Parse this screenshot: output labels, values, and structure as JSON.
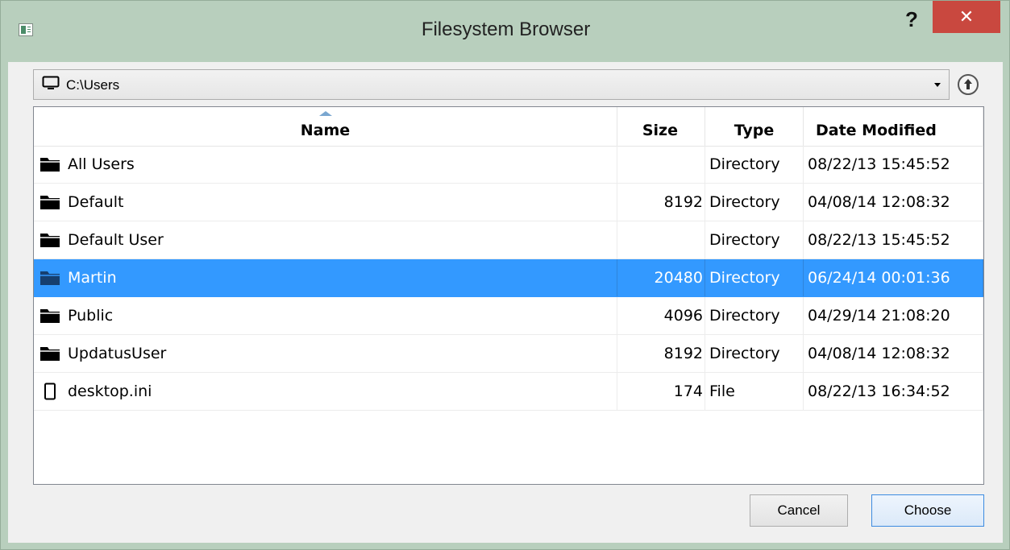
{
  "window": {
    "title": "Filesystem Browser",
    "help_label": "?",
    "close_label": "✕"
  },
  "pathbar": {
    "path": "C:\\Users"
  },
  "columns": {
    "name": "Name",
    "size": "Size",
    "type": "Type",
    "date": "Date Modified",
    "sorted_by": "Name"
  },
  "rows": [
    {
      "name": "All Users",
      "size": "",
      "type": "Directory",
      "date": "08/22/13 15:45:52",
      "icon": "folder-icon",
      "selected": false
    },
    {
      "name": "Default",
      "size": "8192",
      "type": "Directory",
      "date": "04/08/14 12:08:32",
      "icon": "folder-icon",
      "selected": false
    },
    {
      "name": "Default User",
      "size": "",
      "type": "Directory",
      "date": "08/22/13 15:45:52",
      "icon": "folder-icon",
      "selected": false
    },
    {
      "name": "Martin",
      "size": "20480",
      "type": "Directory",
      "date": "06/24/14 00:01:36",
      "icon": "folder-icon",
      "selected": true
    },
    {
      "name": "Public",
      "size": "4096",
      "type": "Directory",
      "date": "04/29/14 21:08:20",
      "icon": "folder-icon",
      "selected": false
    },
    {
      "name": "UpdatusUser",
      "size": "8192",
      "type": "Directory",
      "date": "04/08/14 12:08:32",
      "icon": "folder-icon",
      "selected": false
    },
    {
      "name": "desktop.ini",
      "size": "174",
      "type": "File",
      "date": "08/22/13 16:34:52",
      "icon": "file-icon",
      "selected": false
    }
  ],
  "buttons": {
    "cancel": "Cancel",
    "choose": "Choose"
  },
  "colors": {
    "frame": "#b8cfbd",
    "close": "#c9483f",
    "selection": "#3399ff",
    "selected_icon": "#163f70"
  }
}
